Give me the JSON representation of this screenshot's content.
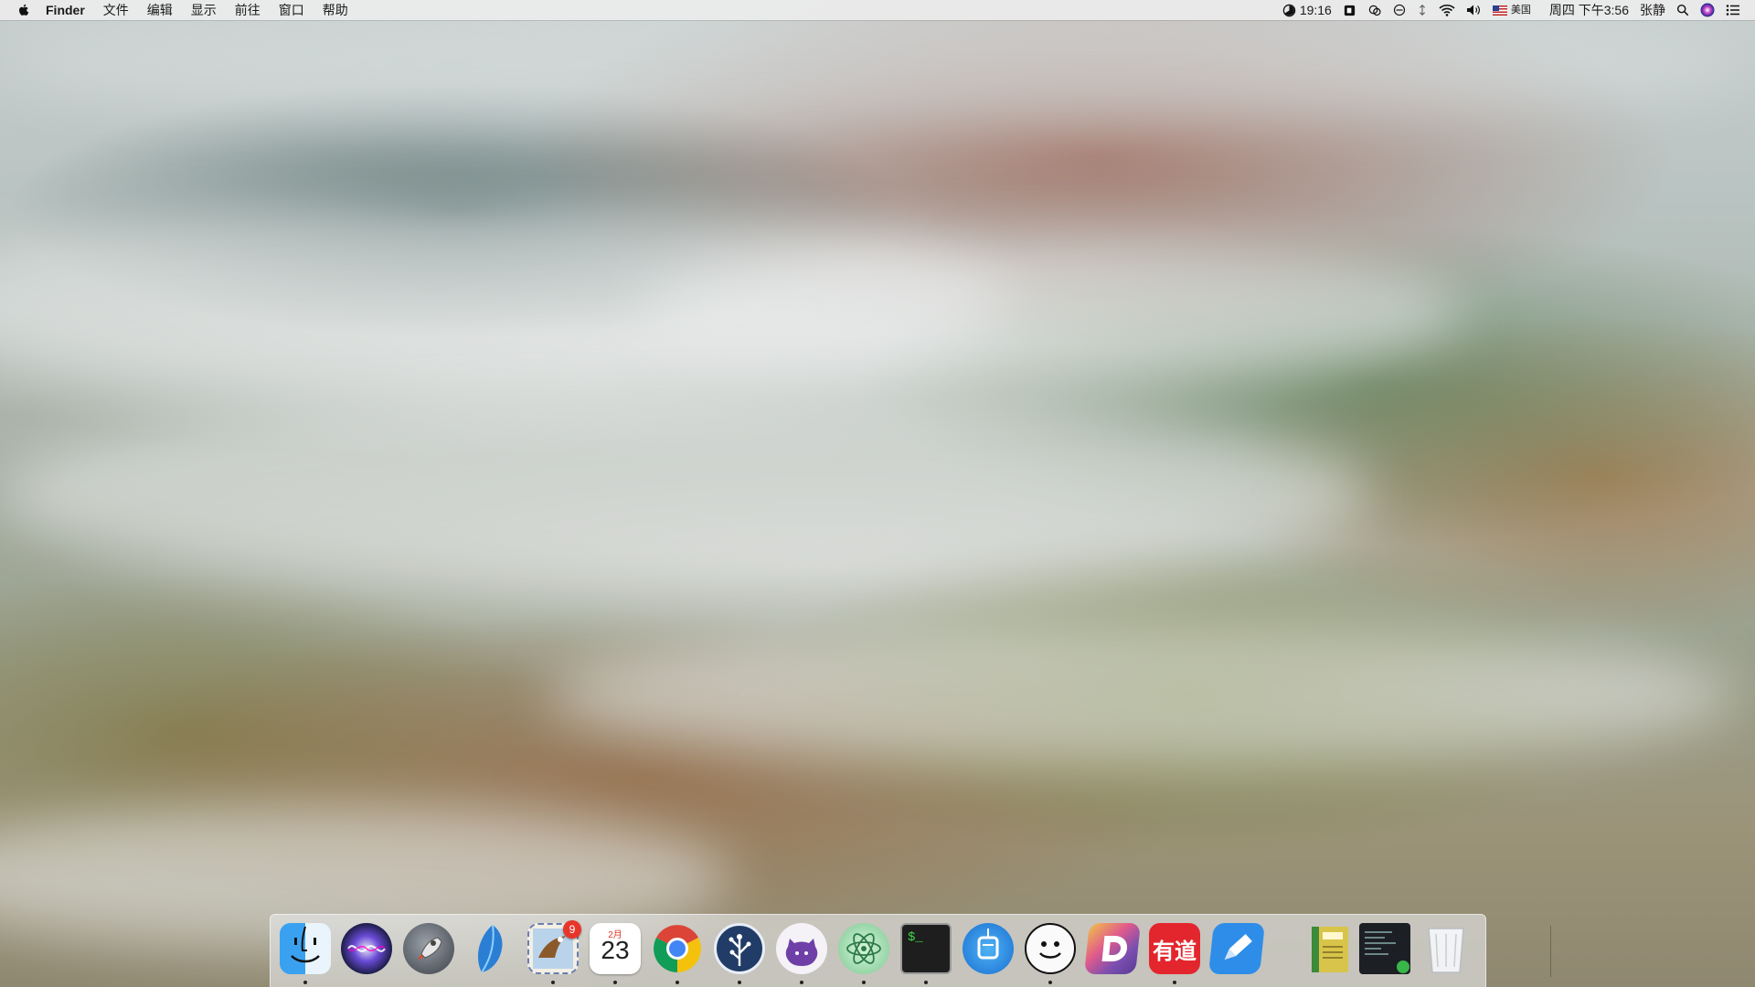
{
  "menubar": {
    "app_name": "Finder",
    "menus": [
      "文件",
      "编辑",
      "显示",
      "前往",
      "窗口",
      "帮助"
    ],
    "status": {
      "clock_app_time": "19:16",
      "input_source": "美国",
      "datetime": "周四 下午3:56",
      "user": "张静"
    }
  },
  "dock": {
    "apps": [
      {
        "name": "Finder",
        "icon": "finder-icon",
        "running": true
      },
      {
        "name": "Siri",
        "icon": "siri-icon",
        "running": false
      },
      {
        "name": "Launchpad",
        "icon": "launchpad-rocket-icon",
        "running": false
      },
      {
        "name": "Sail",
        "icon": "sail-icon",
        "running": false
      },
      {
        "name": "Mail",
        "icon": "mail-stamp-icon",
        "running": true,
        "badge": "9"
      },
      {
        "name": "Calendar",
        "icon": "calendar-icon",
        "running": true,
        "month": "2月",
        "day": "23"
      },
      {
        "name": "Chrome",
        "icon": "chrome-icon",
        "running": true
      },
      {
        "name": "SourceTree",
        "icon": "sourcetree-icon",
        "running": true
      },
      {
        "name": "GitHub Desktop",
        "icon": "github-octocat-icon",
        "running": true
      },
      {
        "name": "Atom",
        "icon": "atom-icon",
        "running": true
      },
      {
        "name": "Terminal",
        "icon": "terminal-icon",
        "running": true,
        "prompt": "$_"
      },
      {
        "name": "Lantern",
        "icon": "lantern-icon",
        "running": false
      },
      {
        "name": "Smiley",
        "icon": "smiley-face-icon",
        "running": true
      },
      {
        "name": "Dash",
        "icon": "dash-icon",
        "running": false
      },
      {
        "name": "Youdao Dictionary",
        "icon": "youdao-icon",
        "running": true,
        "label": "有道"
      },
      {
        "name": "Writer",
        "icon": "pencil-icon",
        "running": false
      },
      {
        "name": "Notebook",
        "icon": "notebook-icon",
        "running": false
      },
      {
        "name": "Screenshot",
        "icon": "screenshot-icon",
        "running": false
      },
      {
        "name": "Trash",
        "icon": "trash-icon",
        "running": false
      }
    ]
  },
  "colors": {
    "menubar_bg": "#ececec",
    "badge_red": "#e8352c",
    "youdao_red": "#e3262d",
    "dash_purple": "#7b4fb0"
  }
}
